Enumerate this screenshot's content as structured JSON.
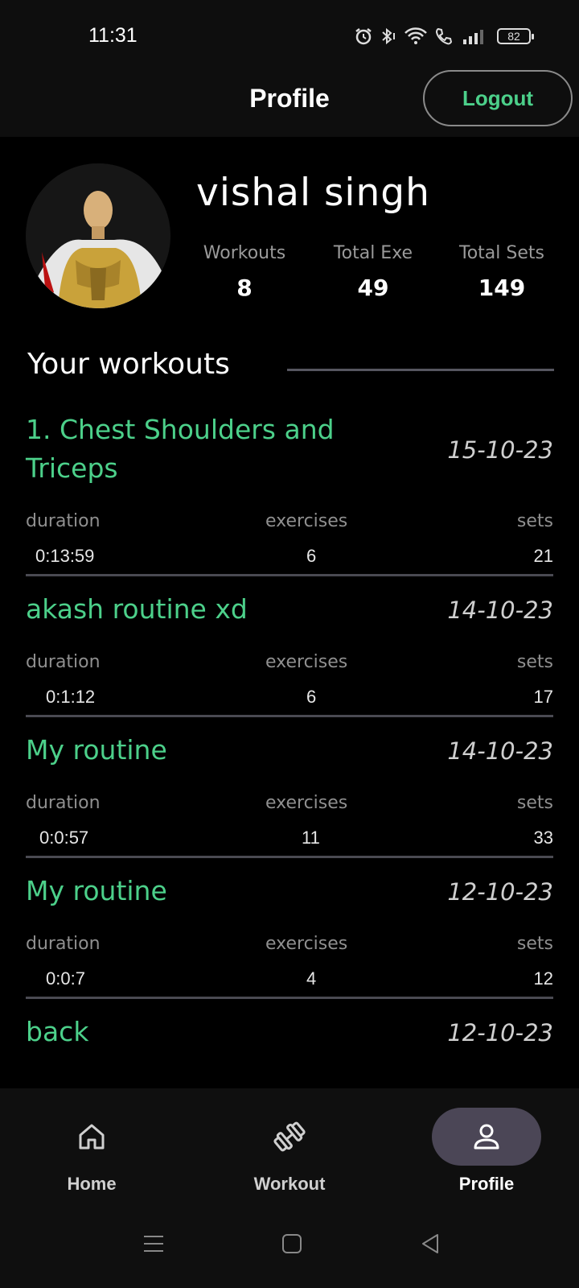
{
  "status_bar": {
    "time": "11:31",
    "battery": "82"
  },
  "header": {
    "title": "Profile",
    "logout_label": "Logout"
  },
  "profile": {
    "name": "vishal singh",
    "stats": [
      {
        "label": "Workouts",
        "value": "8"
      },
      {
        "label": "Total Exe",
        "value": "49"
      },
      {
        "label": "Total Sets",
        "value": "149"
      }
    ]
  },
  "section_title": "Your workouts",
  "metric_labels": {
    "duration": "duration",
    "exercises": "exercises",
    "sets": "sets"
  },
  "workouts": [
    {
      "name": "1. Chest Shoulders and Triceps",
      "date": "15-10-23",
      "duration": "0:13:59",
      "exercises": "6",
      "sets": "21"
    },
    {
      "name": "akash routine xd",
      "date": "14-10-23",
      "duration": "0:1:12",
      "exercises": "6",
      "sets": "17"
    },
    {
      "name": "My routine",
      "date": "14-10-23",
      "duration": "0:0:57",
      "exercises": "11",
      "sets": "33"
    },
    {
      "name": "My routine",
      "date": "12-10-23",
      "duration": "0:0:7",
      "exercises": "4",
      "sets": "12"
    },
    {
      "name": "back",
      "date": "12-10-23"
    }
  ],
  "bottom_nav": [
    {
      "label": "Home",
      "icon": "home-icon",
      "active": false
    },
    {
      "label": "Workout",
      "icon": "dumbbell-icon",
      "active": false
    },
    {
      "label": "Profile",
      "icon": "user-icon",
      "active": true
    }
  ],
  "colors": {
    "accent": "#4cd08a",
    "background": "#000000",
    "bar": "#0e0e0e",
    "active_pill": "#4b4656"
  }
}
